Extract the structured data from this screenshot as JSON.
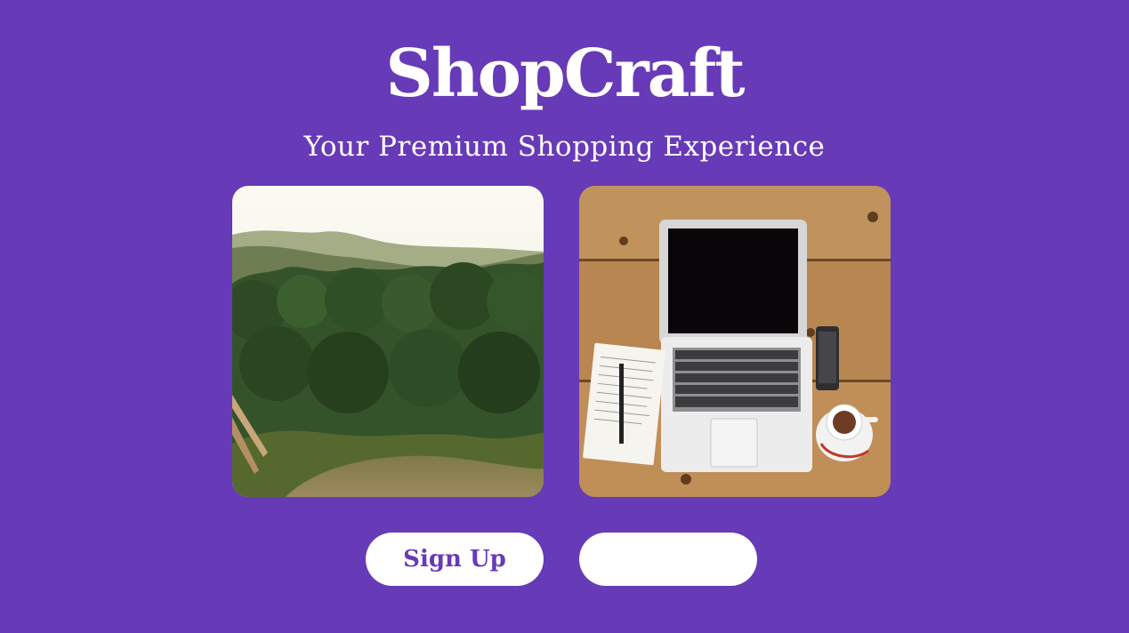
{
  "header": {
    "brand_title": "ShopCraft",
    "tagline": "Your Premium Shopping Experience"
  },
  "gallery": {
    "images": [
      {
        "name": "forest-landscape-image"
      },
      {
        "name": "laptop-desk-image"
      }
    ]
  },
  "actions": {
    "signup_label": "Sign Up",
    "second_label": ""
  },
  "colors": {
    "background": "#673ab7",
    "button_bg": "#ffffff",
    "button_text": "#673ab7",
    "title_text": "#ffffff"
  }
}
